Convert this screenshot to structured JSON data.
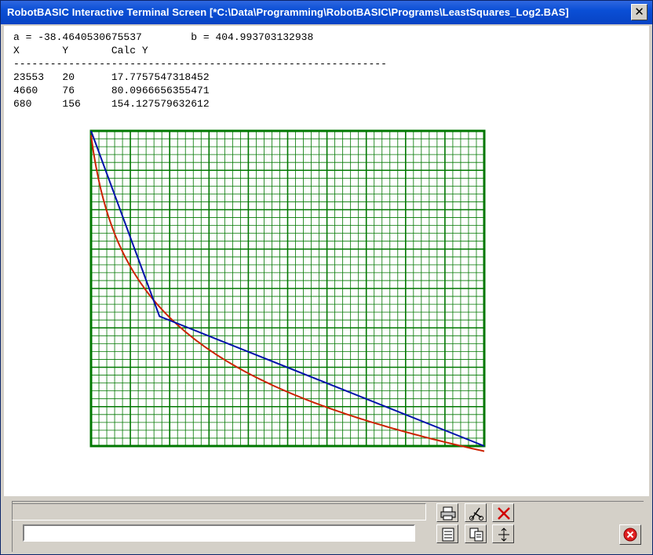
{
  "window": {
    "title": "RobotBASIC Interactive Terminal Screen  [*C:\\Data\\Programming\\RobotBASIC\\Programs\\LeastSquares_Log2.BAS]"
  },
  "output": {
    "lines": [
      "a = -38.4640530675537        b = 404.993703132938",
      "X       Y       Calc Y",
      "-------------------------------------------------------------",
      "23553   20      17.7757547318452",
      "4660    76      80.0966656355471",
      "680     156     154.127579632612"
    ]
  },
  "chart_data": {
    "type": "line",
    "grid": true,
    "colors": {
      "grid": "#007700",
      "fit_curve": "#cc2200",
      "data_line": "#0011aa"
    },
    "series": [
      {
        "values": [
          [
            680,
            156
          ],
          [
            4660,
            76
          ],
          [
            23553,
            20
          ]
        ]
      },
      {
        "function": "a*ln(x)+b",
        "a": -38.4640530675537,
        "b": 404.993703132938
      }
    ]
  },
  "input": {
    "value": ""
  },
  "toolbar": {
    "icons": [
      "printer-icon",
      "cut-icon",
      "clear-icon",
      "list-icon",
      "copy-icon",
      "resize-icon",
      "stop-icon"
    ]
  }
}
